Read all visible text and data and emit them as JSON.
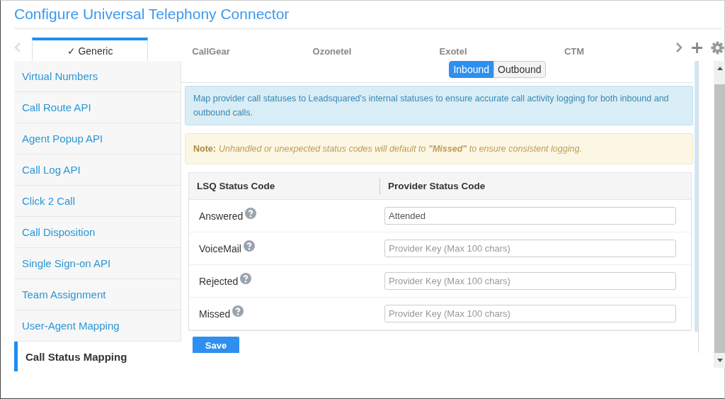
{
  "window": {
    "title": "Configure Universal Telephony Connector"
  },
  "tabs": [
    {
      "label": "✓ Generic",
      "selected": true
    },
    {
      "label": "CallGear",
      "selected": false
    },
    {
      "label": "Ozonetel",
      "selected": false
    },
    {
      "label": "Exotel",
      "selected": false
    },
    {
      "label": "CTM",
      "selected": false
    }
  ],
  "sidebar": {
    "items": [
      {
        "label": "Virtual Numbers",
        "selected": false
      },
      {
        "label": "Call Route API",
        "selected": false
      },
      {
        "label": "Agent Popup API",
        "selected": false
      },
      {
        "label": "Call Log API",
        "selected": false
      },
      {
        "label": "Click 2 Call",
        "selected": false
      },
      {
        "label": "Call Disposition",
        "selected": false
      },
      {
        "label": "Single Sign-on API",
        "selected": false
      },
      {
        "label": "Team Assignment",
        "selected": false
      },
      {
        "label": "User-Agent Mapping",
        "selected": false
      },
      {
        "label": "Call Status Mapping",
        "selected": true
      }
    ]
  },
  "direction_toggle": [
    {
      "label": "Inbound",
      "selected": true
    },
    {
      "label": "Outbound",
      "selected": false
    }
  ],
  "info": "Map provider call statuses to Leadsquared's internal statuses to ensure accurate call activity logging for both inbound and outbound calls.",
  "note": {
    "label": "Note:",
    "text": "Unhandled or unexpected status codes will default to **\"Missed\"** to ensure consistent logging."
  },
  "table": {
    "columns": [
      "LSQ Status Code",
      "Provider Status Code"
    ],
    "rows": [
      {
        "status": "Answered",
        "value": "Attended"
      },
      {
        "status": "VoiceMail",
        "placeholder": "Provider Key (Max 100 chars)"
      },
      {
        "status": "Rejected",
        "placeholder": "Provider Key (Max 100 chars)"
      },
      {
        "status": "Missed",
        "placeholder": "Provider Key (Max 100 chars)"
      }
    ]
  },
  "save_button": "Save"
}
